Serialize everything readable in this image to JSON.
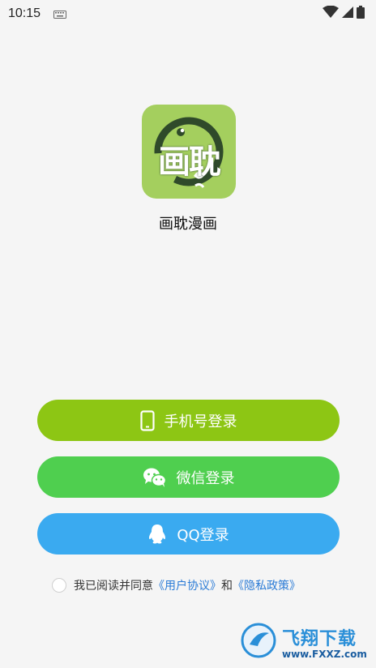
{
  "status_bar": {
    "time": "10:15"
  },
  "app": {
    "name": "画耽漫画",
    "logo_text": "画耽"
  },
  "buttons": {
    "phone_login": {
      "label": "手机号登录",
      "color": "#8dc614"
    },
    "wechat_login": {
      "label": "微信登录",
      "color": "#4fcf4f"
    },
    "qq_login": {
      "label": "QQ登录",
      "color": "#3aaaf0"
    }
  },
  "agreement": {
    "prefix": "我已阅读并同意",
    "user_agreement": "《用户协议》",
    "conjunction": "和",
    "privacy_policy": "《隐私政策》",
    "checked": false
  },
  "watermark": {
    "title": "飞翔下载",
    "url": "www.FXXZ.com"
  },
  "colors": {
    "background": "#f5f5f5",
    "logo_bg": "#a4cf5e",
    "link": "#2b7bd6"
  }
}
